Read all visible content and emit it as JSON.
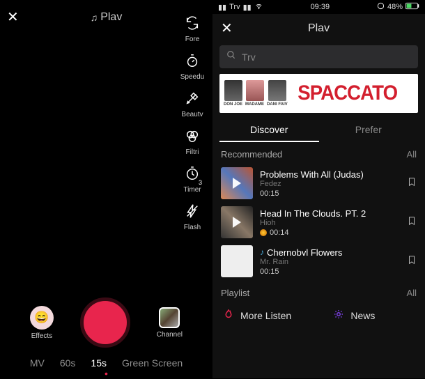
{
  "left": {
    "title": "Plav",
    "tools": {
      "fore": "Fore",
      "speedu": "Speedu",
      "beautv": "Beautv",
      "filtri": "Filtri",
      "timer": "Timer",
      "flash": "Flash"
    },
    "timer_digit": "3",
    "effects_label": "Effects",
    "channel_label": "Channel",
    "modes": {
      "mv": "MV",
      "sixty": "60s",
      "fifteen": "15s",
      "green": "Green Screen"
    }
  },
  "right": {
    "status": {
      "carrier": "Trv",
      "time": "09:39",
      "battery": "48%"
    },
    "title": "Plav",
    "search_placeholder": "Trv",
    "banner": {
      "artists": [
        "DON JOE",
        "MADAME",
        "DANI FAIV"
      ],
      "word": "SPACCATO"
    },
    "tabs": {
      "discover": "Discover",
      "prefer": "Prefer"
    },
    "recommended_label": "Recommended",
    "all_label": "All",
    "songs": [
      {
        "title": "Problems With All (Judas)",
        "artist": "Fedez",
        "duration": "00:15"
      },
      {
        "title": "Head In The Clouds. PT. 2",
        "artist": "Hioh",
        "duration": "00:14"
      },
      {
        "title": "Chernobvl Flowers",
        "artist": "Mr. Rain",
        "duration": "00:15"
      }
    ],
    "playlist_label": "Playlist",
    "all_label2": "All",
    "pl_items": {
      "more_listen": "More Listen",
      "news": "News"
    }
  }
}
